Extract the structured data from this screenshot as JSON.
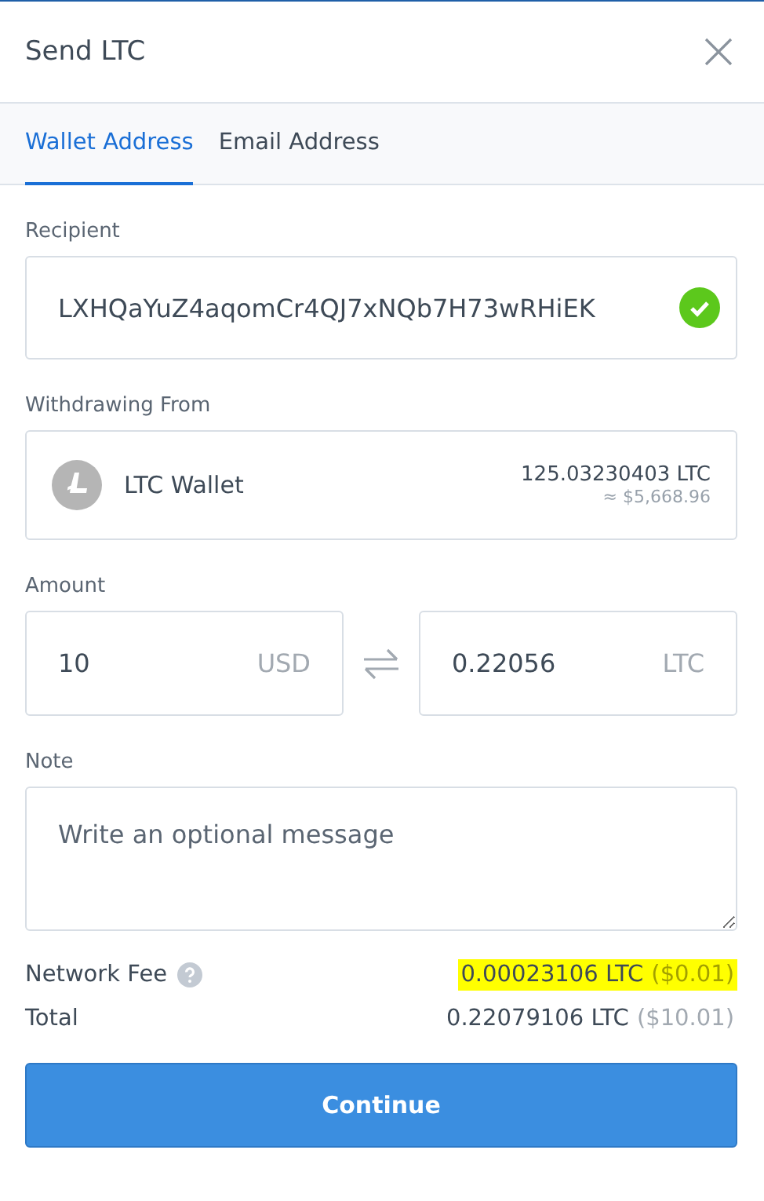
{
  "window": {
    "title": "Send LTC"
  },
  "tabs": [
    {
      "label": "Wallet Address",
      "selected": true
    },
    {
      "label": "Email Address",
      "selected": false
    }
  ],
  "recipient": {
    "label": "Recipient",
    "value": "LXHQaYuZ4aqomCr4QJ7xNQb7H73wRHiEK",
    "valid": true
  },
  "withdrawing_from": {
    "label": "Withdrawing From",
    "wallet": "LTC Wallet",
    "balance": "125.03230403 LTC",
    "balance_fiat": "≈ $5,668.96"
  },
  "amount": {
    "label": "Amount",
    "fiat_value": "10",
    "fiat_currency": "USD",
    "crypto_value": "0.22056",
    "crypto_currency": "LTC"
  },
  "note": {
    "label": "Note",
    "placeholder": "Write an optional message"
  },
  "network_fee": {
    "label": "Network Fee",
    "value": "0.00023106 LTC",
    "fiat": "($0.01)",
    "highlighted": true
  },
  "total": {
    "label": "Total",
    "value": "0.22079106 LTC",
    "fiat": "($10.01)"
  },
  "buttons": [
    "Continue"
  ]
}
